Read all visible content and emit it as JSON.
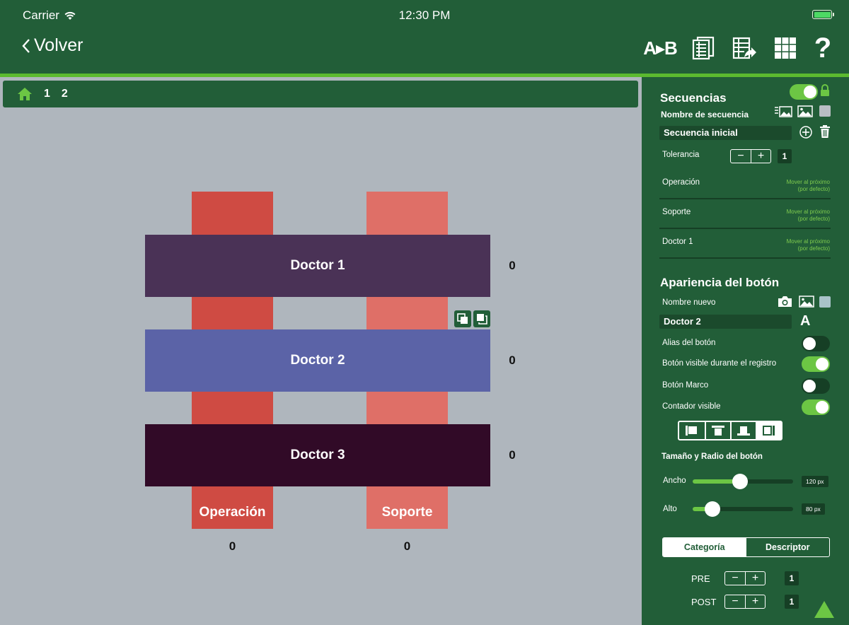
{
  "status": {
    "carrier": "Carrier",
    "time": "12:30 PM"
  },
  "header": {
    "back_label": "Volver",
    "tools": {
      "ab_label": "A▸B",
      "help_label": "?"
    }
  },
  "breadcrumb": {
    "items": [
      "1",
      "2"
    ]
  },
  "canvas": {
    "columns": [
      {
        "label": "Operación",
        "count": "0",
        "color": "#cf4b43"
      },
      {
        "label": "Soporte",
        "count": "0",
        "color": "#df6f67"
      }
    ],
    "rows": [
      {
        "label": "Doctor 1",
        "count": "0",
        "color": "#4a3256"
      },
      {
        "label": "Doctor 2",
        "count": "0",
        "color": "#5b63a7"
      },
      {
        "label": "Doctor 3",
        "count": "0",
        "color": "#310a27"
      }
    ]
  },
  "panel": {
    "secuencias": {
      "title": "Secuencias",
      "toggle_on": true,
      "name_label": "Nombre de secuencia",
      "name_value": "Secuencia inicial",
      "swatch_color": "#b9bec3",
      "tolerancia_label": "Tolerancia",
      "tolerancia_value": "1",
      "items": [
        {
          "label": "Operación",
          "default_text_1": "Mover al próximo",
          "default_text_2": "(por defecto)"
        },
        {
          "label": "Soporte",
          "default_text_1": "Mover al próximo",
          "default_text_2": "(por defecto)"
        },
        {
          "label": "Doctor 1",
          "default_text_1": "Mover al próximo",
          "default_text_2": "(por defecto)"
        }
      ]
    },
    "apariencia": {
      "title": "Apariencia del botón",
      "name_label": "Nombre nuevo",
      "name_value": "Doctor 2",
      "font_label": "A",
      "swatch_color": "#a9c3c9",
      "toggles": [
        {
          "label": "Alias del botón",
          "on": false
        },
        {
          "label": "Botón visible durante el registro",
          "on": true
        },
        {
          "label": "Botón Marco",
          "on": false
        },
        {
          "label": "Contador visible",
          "on": true
        }
      ],
      "size_title": "Tamaño y Radio del botón",
      "ancho_label": "Ancho",
      "ancho_value": "120 px",
      "ancho_fraction": 0.47,
      "alto_label": "Alto",
      "alto_value": "80 px",
      "alto_fraction": 0.2
    },
    "tabs": {
      "categoria": "Categoría",
      "descriptor": "Descriptor",
      "active": "categoria"
    },
    "pre": {
      "label": "PRE",
      "value": "1"
    },
    "post": {
      "label": "POST",
      "value": "1"
    }
  }
}
